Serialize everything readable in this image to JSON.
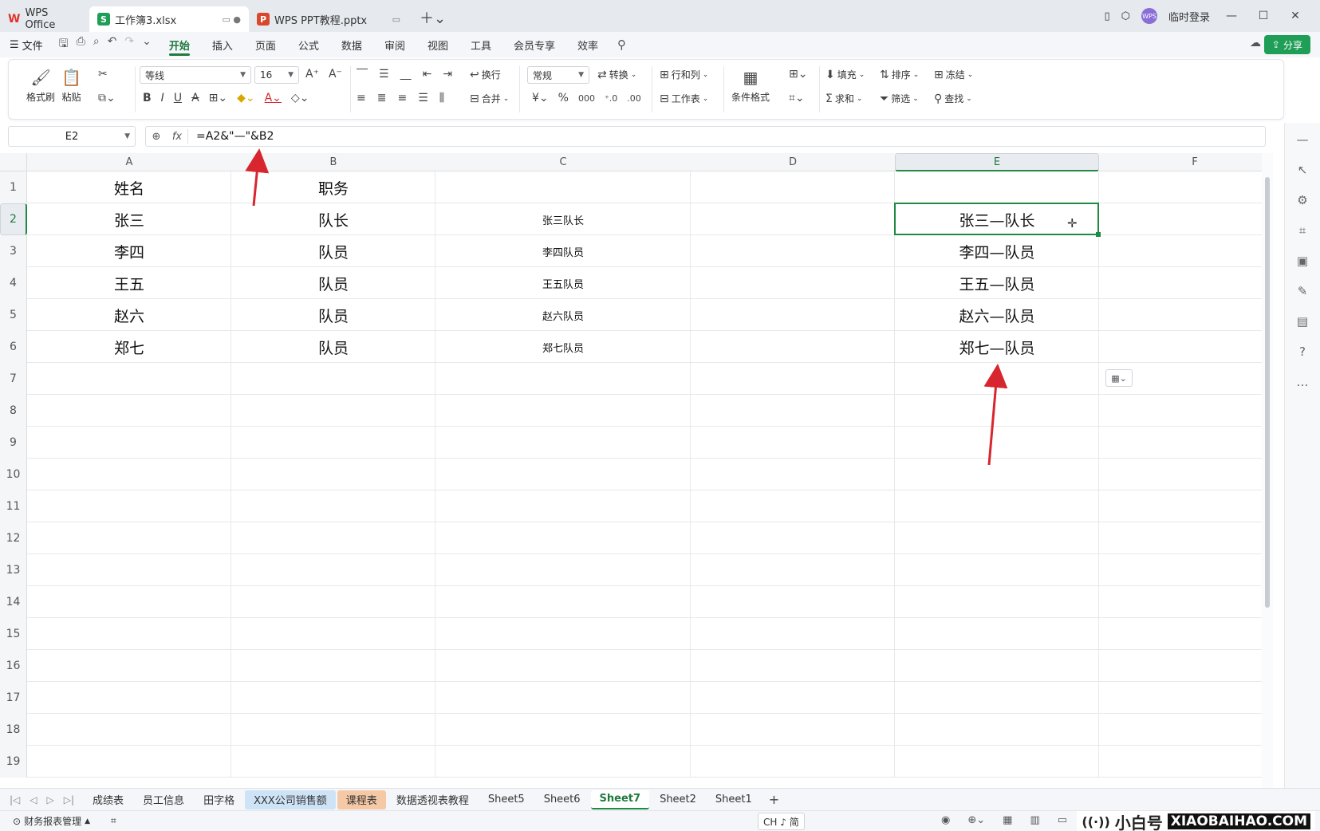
{
  "titlebar": {
    "home_tab": "WPS Office",
    "tabs": [
      {
        "label": "工作簿3.xlsx",
        "type": "sheet"
      },
      {
        "label": "WPS PPT教程.pptx",
        "type": "ppt"
      }
    ],
    "login": "临时登录",
    "avatar": "WPS"
  },
  "menubar": {
    "file": "文件",
    "items": [
      "开始",
      "插入",
      "页面",
      "公式",
      "数据",
      "审阅",
      "视图",
      "工具",
      "会员专享",
      "效率"
    ],
    "share": "分享"
  },
  "ribbon": {
    "format_painter": "格式刷",
    "paste": "粘贴",
    "font_name": "等线",
    "font_size": "16",
    "wrap": "换行",
    "merge": "合并",
    "number_format": "常规",
    "convert": "转换",
    "rows_cols": "行和列",
    "worksheet": "工作表",
    "cond_format": "条件格式",
    "fill": "填充",
    "sort": "排序",
    "freeze": "冻结",
    "sum": "求和",
    "filter": "筛选",
    "find": "查找"
  },
  "formula_bar": {
    "name_box": "E2",
    "fx": "fx",
    "formula": "=A2&\"—\"&B2"
  },
  "grid": {
    "columns": [
      "A",
      "B",
      "C",
      "D",
      "E",
      "F"
    ],
    "rows": [
      "1",
      "2",
      "3",
      "4",
      "5",
      "6",
      "7",
      "8",
      "9",
      "10",
      "11",
      "12",
      "13",
      "14",
      "15",
      "16",
      "17",
      "18",
      "19"
    ],
    "col_a": [
      "姓名",
      "张三",
      "李四",
      "王五",
      "赵六",
      "郑七"
    ],
    "col_b": [
      "职务",
      "队长",
      "队员",
      "队员",
      "队员",
      "队员"
    ],
    "col_c": [
      "",
      "张三队长",
      "李四队员",
      "王五队员",
      "赵六队员",
      "郑七队员"
    ],
    "col_e": [
      "",
      "张三—队长",
      "李四—队员",
      "王五—队员",
      "赵六—队员",
      "郑七—队员"
    ]
  },
  "sheets": {
    "tabs": [
      "成绩表",
      "员工信息",
      "田字格",
      "XXX公司销售额",
      "课程表",
      "数据透视表教程",
      "Sheet5",
      "Sheet6",
      "Sheet7",
      "Sheet2",
      "Sheet1"
    ],
    "active": "Sheet7"
  },
  "statusbar": {
    "left": "财务报表管理",
    "ime": "CH ♪ 简"
  },
  "watermark": {
    "brand": "小白号",
    "url": "XIAOBAIHAO.COM"
  },
  "colors": {
    "accent": "#1f8a43",
    "arrow": "#d7262e"
  }
}
